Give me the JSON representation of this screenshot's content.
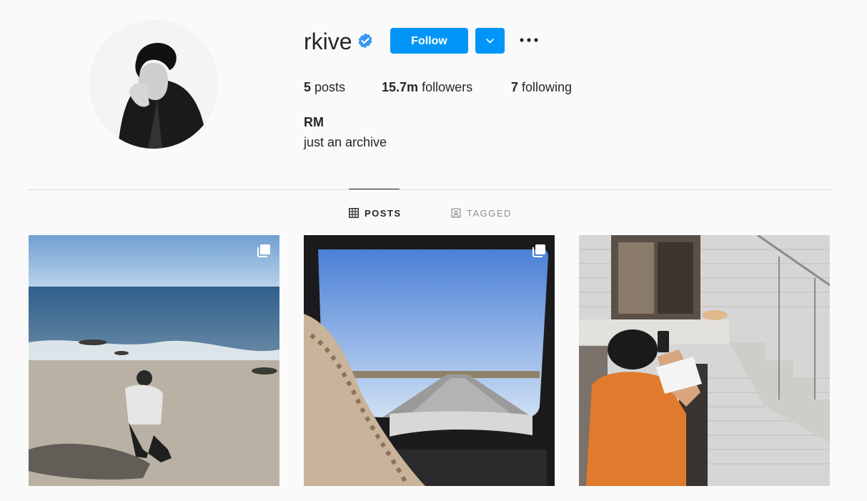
{
  "profile": {
    "username": "rkive",
    "follow_label": "Follow",
    "full_name": "RM",
    "bio": "just an archive"
  },
  "stats": {
    "posts_count": "5",
    "posts_label": "posts",
    "followers_count": "15.7m",
    "followers_label": "followers",
    "following_count": "7",
    "following_label": "following"
  },
  "tabs": {
    "posts": "POSTS",
    "tagged": "TAGGED"
  },
  "icons": {
    "verified": "verified-badge-icon",
    "dropdown": "chevron-down-icon",
    "options": "more-options-icon",
    "grid": "grid-icon",
    "tagged": "tagged-user-icon",
    "multi": "multiple-photos-icon"
  },
  "colors": {
    "accent": "#0095f6",
    "text": "#262626",
    "muted": "#8e8e8e",
    "background": "#fafafa",
    "divider": "#dbdbdb"
  },
  "posts": [
    {
      "kind": "beach photo",
      "multiple": true
    },
    {
      "kind": "car window road photo",
      "multiple": true
    },
    {
      "kind": "building stairs photo",
      "multiple": false
    }
  ]
}
